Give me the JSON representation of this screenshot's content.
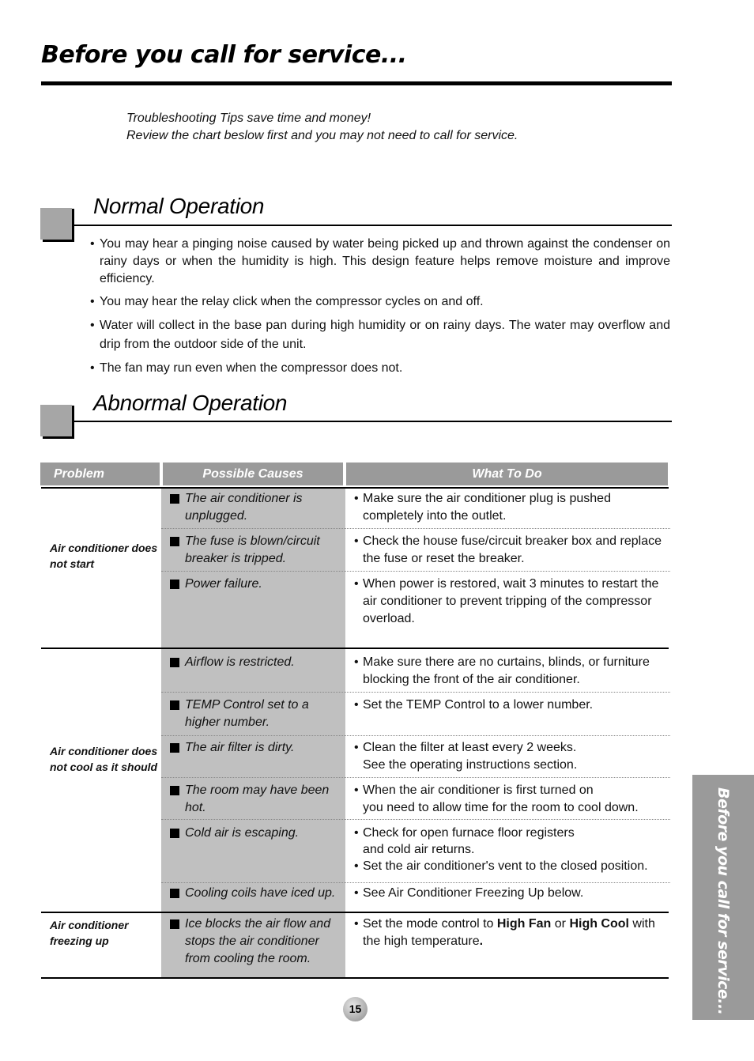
{
  "page": {
    "title": "Before you call for service...",
    "intro_line1": "Troubleshooting Tips save time and money!",
    "intro_line2": "Review the chart beslow first and you may not need to call for service.",
    "page_number": "15",
    "side_tab": "Before you call for service..."
  },
  "normal": {
    "heading": "Normal Operation",
    "bullets": [
      "You may hear a pinging noise caused by water being picked up and thrown against the condenser on rainy days or when the humidity is high. This design feature helps remove moisture and improve efficiency.",
      "You may hear the relay click when the compressor cycles on and off.",
      "Water will collect in the base pan during high humidity or on rainy days. The water may overflow and drip from the outdoor side of the unit.",
      "The fan may run even when the compressor does not."
    ]
  },
  "abnormal": {
    "heading": "Abnormal Operation",
    "table": {
      "headers": {
        "problem": "Problem",
        "causes": "Possible Causes",
        "todo": "What To Do"
      },
      "groups": [
        {
          "problem": "Air conditioner does not start",
          "rows": [
            {
              "cause": "The air conditioner is unplugged.",
              "todo": [
                "Make sure the air conditioner plug is pushed completely into the outlet."
              ]
            },
            {
              "cause": "The fuse is blown/circuit breaker is tripped.",
              "todo": [
                "Check the house fuse/circuit breaker box and replace the fuse or reset the breaker."
              ]
            },
            {
              "cause": "Power failure.",
              "todo": [
                "When power is restored, wait 3 minutes to restart the air conditioner to prevent tripping of the compressor overload."
              ]
            }
          ]
        },
        {
          "problem": "Air conditioner does not cool as it should",
          "rows": [
            {
              "cause": "Airflow is restricted.",
              "todo": [
                "Make sure there are no curtains, blinds, or furniture blocking the front of the air conditioner."
              ]
            },
            {
              "cause": "TEMP Control set to a higher number.",
              "todo": [
                "Set the TEMP Control to a lower number."
              ]
            },
            {
              "cause": "The air filter is dirty.",
              "todo": [
                "Clean the filter at least every 2 weeks.",
                "See the operating instructions section."
              ]
            },
            {
              "cause": "The room may have been hot.",
              "todo": [
                "When the air conditioner is first turned on",
                "you need to allow time for the room to cool down."
              ]
            },
            {
              "cause": "Cold air is escaping.",
              "todo": [
                "Check for open furnace floor registers",
                "and cold air returns.",
                "Set the air conditioner's vent to the closed position."
              ]
            },
            {
              "cause": "Cooling coils have iced up.",
              "todo": [
                "See Air Conditioner Freezing Up below."
              ]
            }
          ]
        },
        {
          "problem": "Air conditioner freezing up",
          "rows": [
            {
              "cause": "Ice blocks the air flow and stops the air conditioner from cooling the room.",
              "todo_parts": [
                "Set the mode control to ",
                "High Fan",
                " or ",
                "High Cool",
                " with the high temperature",
                "."
              ]
            }
          ]
        }
      ]
    }
  },
  "colors": {
    "header_bg": "#9a9a9a",
    "causes_bg": "#c0c0c0",
    "marker": "#a6a6a6",
    "side_tab": "#9a9a9a"
  }
}
